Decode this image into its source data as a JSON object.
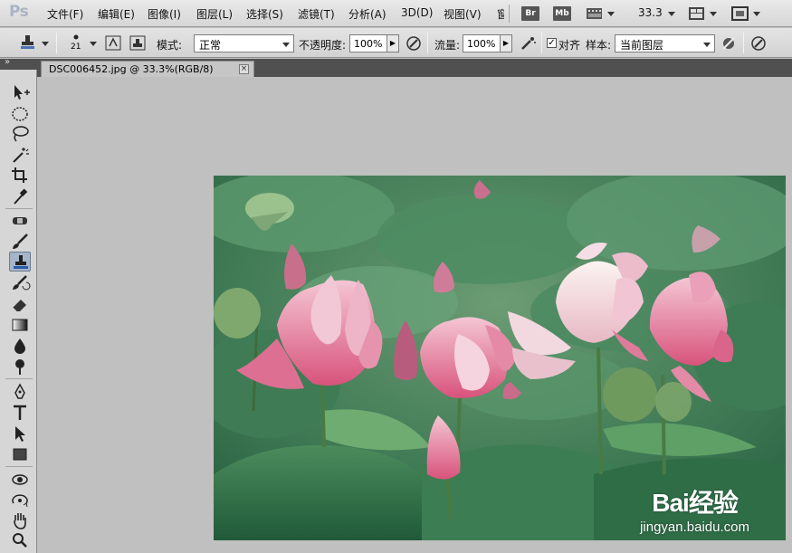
{
  "app": {
    "logo": "Ps"
  },
  "menu": {
    "items": [
      "文件(F)",
      "编辑(E)",
      "图像(I)",
      "图层(L)",
      "选择(S)",
      "滤镜(T)",
      "分析(A)",
      "3D(D)",
      "视图(V)",
      "窗"
    ],
    "bridge_label": "Br",
    "minibridge_label": "Mb",
    "zoom_value": "33.3"
  },
  "options": {
    "mode_label": "模式:",
    "mode_value": "正常",
    "opacity_label": "不透明度:",
    "opacity_value": "100%",
    "flow_label": "流量:",
    "flow_value": "100%",
    "aligned_label": "对齐",
    "aligned_checked": "✓",
    "sample_label": "样本:",
    "sample_value": "当前图层",
    "brush_size": "21"
  },
  "toolbox": {
    "tools": [
      "move",
      "marquee",
      "lasso",
      "quick-selection",
      "crop",
      "eyedropper",
      "spot-healing",
      "brush",
      "clone-stamp",
      "history-brush",
      "eraser",
      "gradient",
      "blur",
      "dodge",
      "pen",
      "type",
      "path-selection",
      "rectangle",
      "3d-rotate",
      "3d-orbit",
      "hand",
      "zoom"
    ],
    "active_tool": "clone-stamp"
  },
  "document": {
    "tab_title": "DSC006452.jpg @ 33.3%(RGB/8)",
    "close_glyph": "×"
  },
  "watermark": {
    "logo_text": "Bai经验",
    "url": "jingyan.baidu.com"
  },
  "colors": {
    "workspace": "#c0c0c0",
    "active_tool_bg": "#a7b5c9",
    "tab_bar": "#505050"
  }
}
